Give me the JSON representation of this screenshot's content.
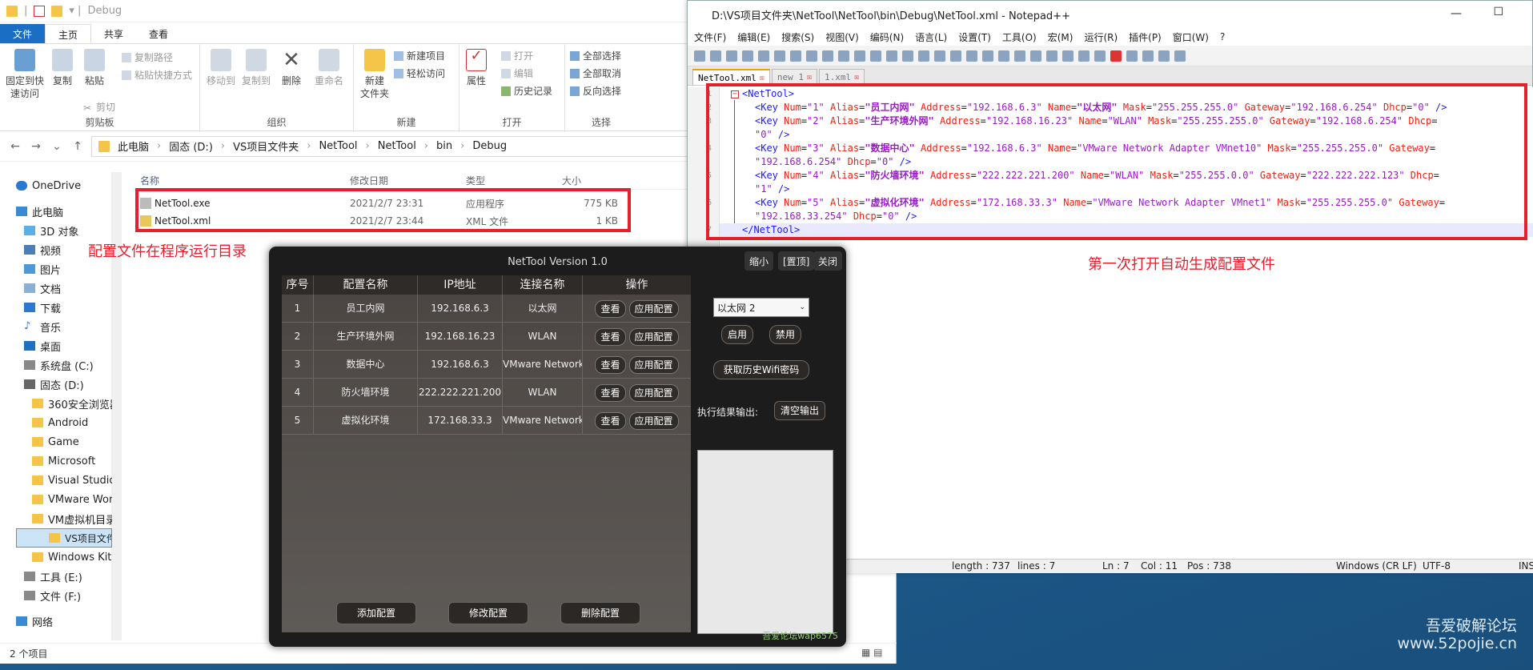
{
  "explorer": {
    "title": "Debug",
    "ribbon_tabs": [
      "文件",
      "主页",
      "共享",
      "查看"
    ],
    "clipboard": {
      "pin": "固定到快\n速访问",
      "copy": "复制",
      "paste": "粘贴",
      "copy_path": "复制路径",
      "paste_shortcut": "粘贴快捷方式",
      "cut": "剪切",
      "group": "剪贴板"
    },
    "organize": {
      "move_to": "移动到",
      "copy_to": "复制到",
      "delete": "删除",
      "rename": "重命名",
      "group": "组织"
    },
    "new": {
      "new_folder": "新建\n文件夹",
      "new_item": "新建项目",
      "easy_access": "轻松访问",
      "group": "新建"
    },
    "open": {
      "properties": "属性",
      "open": "打开",
      "edit": "编辑",
      "history": "历史记录",
      "group": "打开"
    },
    "select": {
      "select_all": "全部选择",
      "select_none": "全部取消",
      "invert": "反向选择",
      "group": "选择"
    },
    "breadcrumb": [
      "此电脑",
      "固态 (D:)",
      "VS项目文件夹",
      "NetTool",
      "NetTool",
      "bin",
      "Debug"
    ],
    "nav_tree": [
      {
        "label": "OneDrive"
      },
      {
        "label": "此电脑"
      },
      {
        "label": "3D 对象"
      },
      {
        "label": "视频"
      },
      {
        "label": "图片"
      },
      {
        "label": "文档"
      },
      {
        "label": "下载"
      },
      {
        "label": "音乐"
      },
      {
        "label": "桌面"
      },
      {
        "label": "系统盘 (C:)"
      },
      {
        "label": "固态 (D:)"
      },
      {
        "label": "360安全浏览器"
      },
      {
        "label": "Android"
      },
      {
        "label": "Game"
      },
      {
        "label": "Microsoft"
      },
      {
        "label": "Visual Studio"
      },
      {
        "label": "VMware Wor"
      },
      {
        "label": "VM虚拟机目录"
      },
      {
        "label": "VS项目文件夹"
      },
      {
        "label": "Windows Kits"
      },
      {
        "label": "工具 (E:)"
      },
      {
        "label": "文件 (F:)"
      },
      {
        "label": "网络"
      }
    ],
    "columns": [
      "名称",
      "修改日期",
      "类型",
      "大小"
    ],
    "files": [
      {
        "name": "NetTool.exe",
        "date": "2021/2/7 23:31",
        "type": "应用程序",
        "size": "775 KB"
      },
      {
        "name": "NetTool.xml",
        "date": "2021/2/7 23:44",
        "type": "XML 文件",
        "size": "1 KB"
      }
    ],
    "note": "配置文件在程序运行目录",
    "status": "2 个项目"
  },
  "notepad": {
    "title": "D:\\VS项目文件夹\\NetTool\\NetTool\\bin\\Debug\\NetTool.xml - Notepad++",
    "menu": [
      "文件(F)",
      "编辑(E)",
      "搜索(S)",
      "视图(V)",
      "编码(N)",
      "语言(L)",
      "设置(T)",
      "工具(O)",
      "宏(M)",
      "运行(R)",
      "插件(P)",
      "窗口(W)",
      "?"
    ],
    "tabs": [
      "NetTool.xml",
      "new 1",
      "1.xml"
    ],
    "lines": [
      "1",
      "2",
      "3",
      "4",
      "5",
      "6",
      "7"
    ],
    "code": {
      "l1": "<NetTool>",
      "k1": {
        "num": "\"1\"",
        "alias": "\"员工内网\"",
        "addr": "\"192.168.6.3\"",
        "name": "\"以太网\"",
        "mask": "\"255.255.255.0\"",
        "gw": "\"192.168.6.254\"",
        "dhcp": "\"0\""
      },
      "k2": {
        "num": "\"2\"",
        "alias": "\"生产环境外网\"",
        "addr": "\"192.168.16.23\"",
        "name": "\"WLAN\"",
        "mask": "\"255.255.255.0\"",
        "gw": "\"192.168.6.254\"",
        "dhcp": "\"0\""
      },
      "k3": {
        "num": "\"3\"",
        "alias": "\"数据中心\"",
        "addr": "\"192.168.6.3\"",
        "name": "\"VMware Network Adapter VMnet10\"",
        "mask": "\"255.255.255.0\"",
        "gw": "\"192.168.6.254\"",
        "dhcp": "\"0\""
      },
      "k4": {
        "num": "\"4\"",
        "alias": "\"防火墙环境\"",
        "addr": "\"222.222.221.200\"",
        "name": "\"WLAN\"",
        "mask": "\"255.255.0.0\"",
        "gw": "\"222.222.222.123\"",
        "dhcp": "\"1\""
      },
      "k5": {
        "num": "\"5\"",
        "alias": "\"虚拟化环境\"",
        "addr": "\"172.168.33.3\"",
        "name": "\"VMware Network Adapter VMnet1\"",
        "mask": "\"255.255.255.0\"",
        "gw": "\"192.168.33.254\"",
        "dhcp": "\"0\""
      },
      "l7": "</NetTool>"
    },
    "note": "第一次打开自动生成配置文件",
    "status": {
      "length": "length : 737",
      "lines": "lines : 7",
      "ln": "Ln : 7",
      "col": "Col : 11",
      "pos": "Pos : 738",
      "eol": "Windows (CR LF)",
      "enc": "UTF-8",
      "ins": "INS"
    }
  },
  "nettool": {
    "title": "NetTool Version 1.0",
    "buttons": {
      "min": "缩小",
      "top": "[置顶]",
      "close": "关闭"
    },
    "columns": [
      "序号",
      "配置名称",
      "IP地址",
      "连接名称",
      "操作"
    ],
    "rows": [
      {
        "no": "1",
        "name": "员工内网",
        "ip": "192.168.6.3",
        "conn": "以太网"
      },
      {
        "no": "2",
        "name": "生产环境外网",
        "ip": "192.168.16.23",
        "conn": "WLAN"
      },
      {
        "no": "3",
        "name": "数据中心",
        "ip": "192.168.6.3",
        "conn": "VMware Network"
      },
      {
        "no": "4",
        "name": "防火墙环境",
        "ip": "222.222.221.200",
        "conn": "WLAN"
      },
      {
        "no": "5",
        "name": "虚拟化环境",
        "ip": "172.168.33.3",
        "conn": "VMware Network"
      }
    ],
    "view_label": "查看",
    "apply_label": "应用配置",
    "adapter": "以太网 2",
    "enable": "启用",
    "disable": "禁用",
    "wifi": "获取历史Wifi密码",
    "output_label": "执行结果输出:",
    "clear": "清空输出",
    "add": "添加配置",
    "modify": "修改配置",
    "delete": "删除配置",
    "signature": "吾爱论坛wap6575"
  },
  "desktop": {
    "watermark_cn": "吾爱破解论坛",
    "watermark_url": "www.52pojie.cn"
  }
}
